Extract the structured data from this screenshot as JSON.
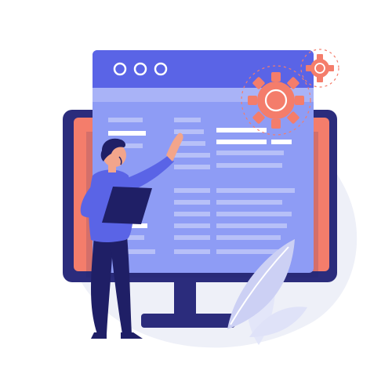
{
  "illustration": {
    "palette": {
      "background": "#ffffff",
      "blob": "#eef0f8",
      "monitor_frame": "#2b2c7c",
      "monitor_dark": "#1f1f66",
      "monitor_salmon": "#f47d6b",
      "window_body": "#8e9cf5",
      "window_titlebar": "#5a64e6",
      "window_rows": "#b7c0f8",
      "window_rows_white": "#ffffff",
      "gear": "#f47d6b",
      "gear_outline": "#f47d6b",
      "person_shirt": "#5a64e6",
      "person_pants": "#1f1f66",
      "person_skin": "#f2a58b",
      "person_hair": "#1f1f66",
      "tablet": "#1f1f66",
      "leaf_front": "#ccd0f4",
      "leaf_back": "#e3e6f9",
      "stand": "#2b2c7c"
    },
    "icons": [
      "window-dot-icon",
      "gear-icon",
      "leaf-icon"
    ]
  }
}
